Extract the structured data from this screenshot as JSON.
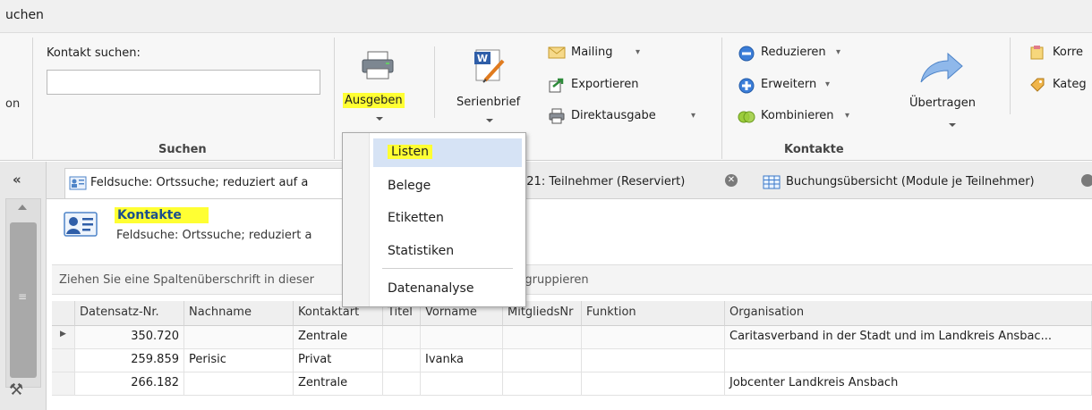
{
  "ribbon_tab": "uchen",
  "left_cut_label": "on",
  "search": {
    "label": "Kontakt suchen:",
    "value": "",
    "group_label": "Suchen"
  },
  "output": {
    "ausgeben_label": "Ausgeben",
    "serienbrief_label": "Serienbrief",
    "mailing_label": "Mailing",
    "exportieren_label": "Exportieren",
    "direktausgabe_label": "Direktausgabe"
  },
  "kontakte_group": {
    "reduzieren_label": "Reduzieren",
    "erweitern_label": "Erweitern",
    "kombinieren_label": "Kombinieren",
    "uebertragen_label": "Übertragen",
    "korre_label": "Korre",
    "kateg_label": "Kateg",
    "group_label": "Kontakte"
  },
  "menu": {
    "items": [
      "Listen",
      "Belege",
      "Etiketten",
      "Statistiken",
      "Datenanalyse"
    ],
    "highlighted_index": 0
  },
  "tabs": [
    {
      "label": "Feldsuche: Ortssuche; reduziert auf a"
    },
    {
      "label": "721: Teilnehmer (Reserviert)"
    },
    {
      "label": "Buchungsübersicht (Module je Teilnehmer)"
    }
  ],
  "panel": {
    "title": "Kontakte",
    "subtitle": "Feldsuche: Ortssuche; reduziert a"
  },
  "group_hint_left": "Ziehen Sie eine Spaltenüberschrift in dieser",
  "group_hint_right": "n gruppieren",
  "grid": {
    "columns": [
      "Datensatz-Nr.",
      "Nachname",
      "Kontaktart",
      "Titel",
      "Vorname",
      "MitgliedsNr",
      "Funktion",
      "Organisation"
    ],
    "rows": [
      {
        "id": "350.720",
        "nachname": "",
        "kontaktart": "Zentrale",
        "titel": "",
        "vorname": "",
        "mitgliedsnr": "",
        "funktion": "",
        "organisation": "Caritasverband in der Stadt und im Landkreis Ansbac..."
      },
      {
        "id": "259.859",
        "nachname": "Perisic",
        "kontaktart": "Privat",
        "titel": "",
        "vorname": "Ivanka",
        "mitgliedsnr": "",
        "funktion": "",
        "organisation": ""
      },
      {
        "id": "266.182",
        "nachname": "",
        "kontaktart": "Zentrale",
        "titel": "",
        "vorname": "",
        "mitgliedsnr": "",
        "funktion": "",
        "organisation": "Jobcenter Landkreis Ansbach"
      }
    ]
  },
  "colors": {
    "highlight": "#ffff33",
    "menu_hover": "#d6e3f5",
    "accent_blue": "#2f6fc6"
  }
}
